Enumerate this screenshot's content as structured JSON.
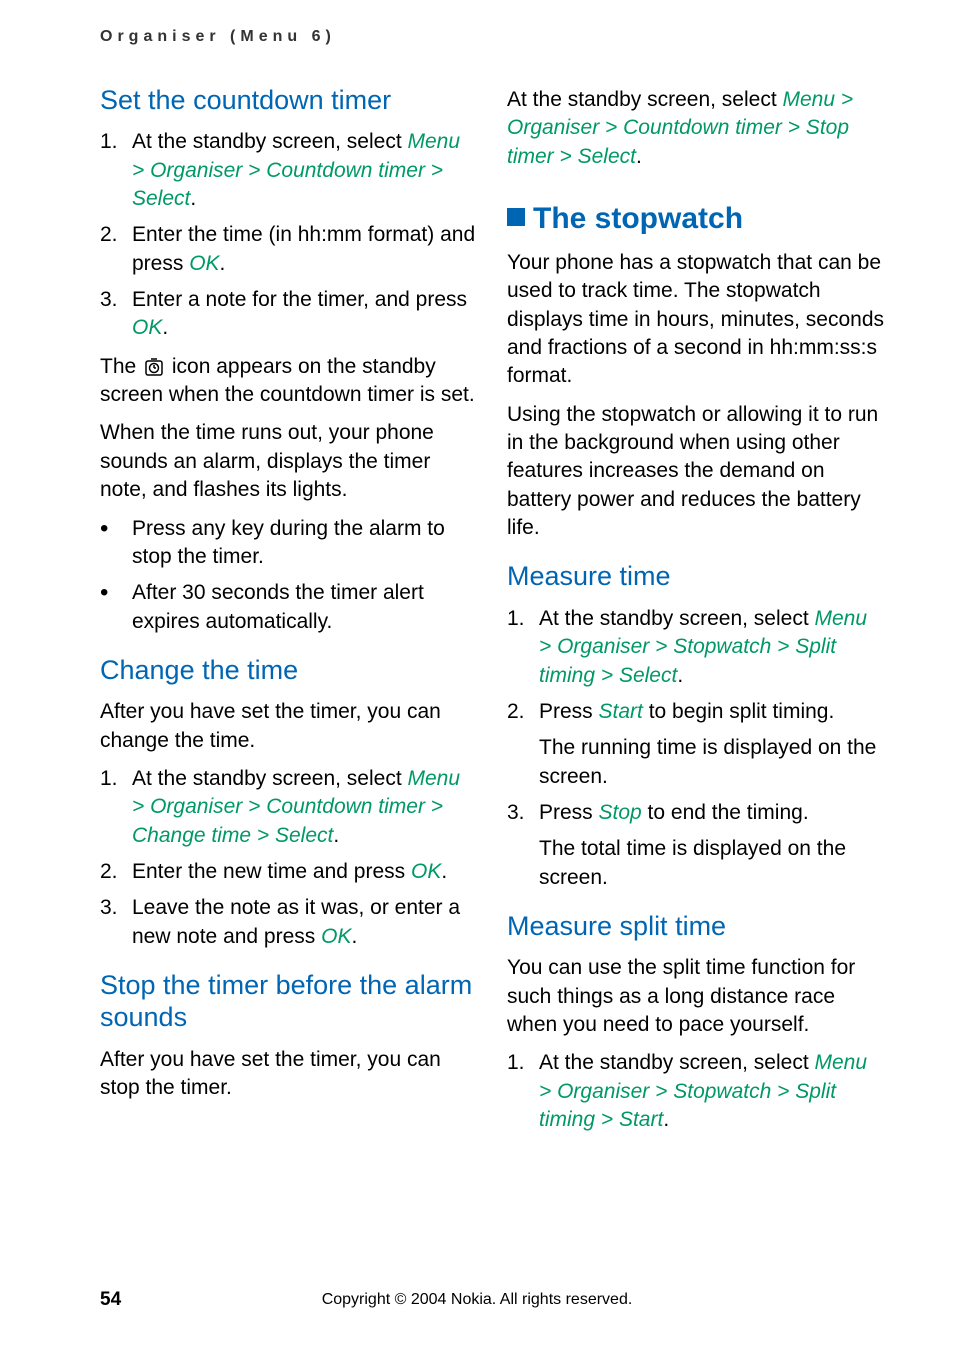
{
  "header": {
    "breadcrumb": "Organiser (Menu 6)"
  },
  "footer": {
    "page": "54",
    "copyright": "Copyright © 2004 Nokia. All rights reserved."
  },
  "left": {
    "set_timer": {
      "title": "Set the countdown timer",
      "steps": {
        "s1_pre": "At the standby screen, select ",
        "s1_path": "Menu > Organiser > Countdown timer > Select",
        "s1_post": ".",
        "s2_pre": "Enter the time (in hh:mm format) and press ",
        "s2_ok": "OK",
        "s2_post": ".",
        "s3_pre": "Enter a note for the timer, and press ",
        "s3_ok": "OK",
        "s3_post": "."
      },
      "icon_para_pre": "The ",
      "icon_para_post": " icon appears on the standby screen when the countdown timer is set.",
      "timeout_para": "When the time runs out, your phone sounds an alarm, displays the timer note, and flashes its lights.",
      "bullet1": "Press any key during the alarm to stop the timer.",
      "bullet2": "After 30 seconds the timer alert expires automatically."
    },
    "change_time": {
      "title": "Change the time",
      "intro": "After you have set the timer, you can change the time.",
      "s1_pre": "At the standby screen, select ",
      "s1_path": "Menu > Organiser > Countdown timer > Change time > Select",
      "s1_post": ".",
      "s2_pre": "Enter the new time and press ",
      "s2_ok": "OK",
      "s2_post": ".",
      "s3_pre": "Leave the note as it was, or enter a new note and press ",
      "s3_ok": "OK",
      "s3_post": "."
    },
    "stop_timer": {
      "title": "Stop the timer before the alarm sounds",
      "intro": "After you have set the timer, you can stop the timer."
    }
  },
  "right": {
    "stop_cont": {
      "pre": "At the standby screen, select ",
      "path": "Menu > Organiser > Countdown timer > Stop timer > Select",
      "post": "."
    },
    "stopwatch": {
      "title": "The stopwatch",
      "p1": "Your phone has a stopwatch that can be used to track time. The stopwatch displays time in hours, minutes, seconds and fractions of a second in hh:mm:ss:s format.",
      "p2": "Using the stopwatch or allowing it to run in the background when using other features increases the demand on battery power and reduces the battery life."
    },
    "measure_time": {
      "title": "Measure time",
      "s1_pre": "At the standby screen, select ",
      "s1_path": "Menu > Organiser > Stopwatch > Split timing > Select",
      "s1_post": ".",
      "s2_pre": "Press ",
      "s2_start": "Start",
      "s2_post": " to begin split timing.",
      "s2_sub": "The running time is displayed on the screen.",
      "s3_pre": "Press ",
      "s3_stop": "Stop",
      "s3_post": " to end the timing.",
      "s3_sub": "The total time is displayed on the screen."
    },
    "measure_split": {
      "title": "Measure split time",
      "intro": "You can use the split time function for such things as a long distance race when you need to pace yourself.",
      "s1_pre": "At the standby screen, select ",
      "s1_path": "Menu > Organiser > Stopwatch > Split timing > Start",
      "s1_post": "."
    }
  }
}
